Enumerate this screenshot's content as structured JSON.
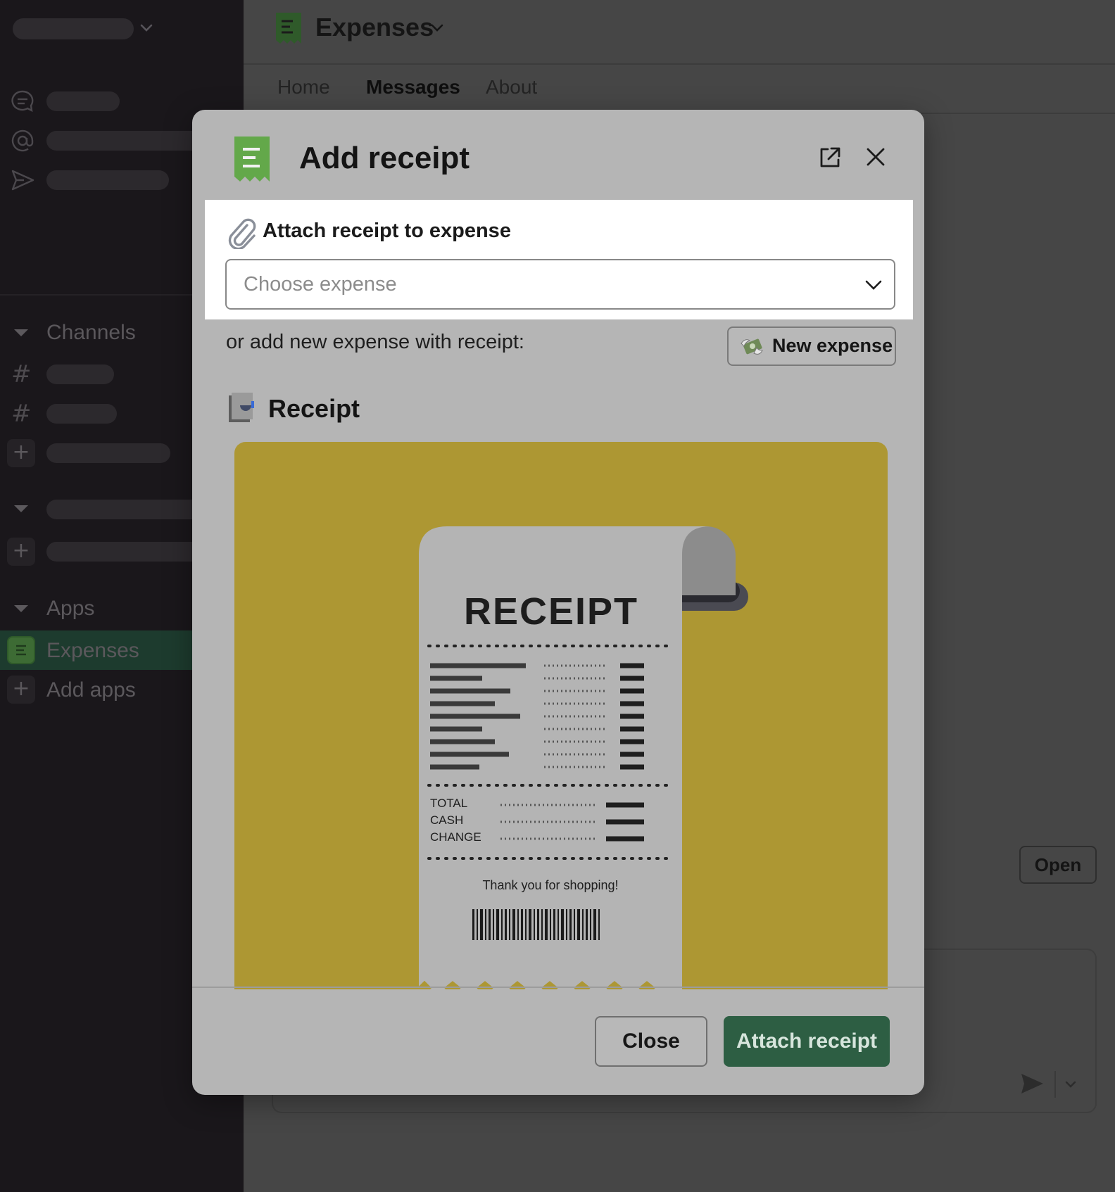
{
  "sidebar": {
    "sections": {
      "channels": "Channels",
      "apps": "Apps"
    },
    "apps": [
      {
        "label": "Expenses",
        "active": true
      },
      {
        "label": "Add apps",
        "active": false
      }
    ]
  },
  "header": {
    "app_title": "Expenses",
    "tabs": [
      {
        "label": "Home"
      },
      {
        "label": "Messages",
        "active": true
      },
      {
        "label": "About"
      }
    ]
  },
  "main": {
    "open_button": "Open"
  },
  "modal": {
    "title": "Add receipt",
    "attach_label": "Attach receipt to expense",
    "select": {
      "placeholder": "Choose expense"
    },
    "or_text": "or add new expense with receipt:",
    "new_expense_button": "New expense",
    "receipt_heading": "Receipt",
    "receipt_image": {
      "title": "RECEIPT",
      "totals": [
        "TOTAL",
        "CASH",
        "CHANGE"
      ],
      "thanks": "Thank you for shopping!"
    },
    "footer": {
      "close_button": "Close",
      "attach_button": "Attach receipt"
    }
  },
  "colors": {
    "brand_green": "#4a8a3a",
    "primary_button": "#2d5e43",
    "illustration_bg": "#ad9733"
  }
}
